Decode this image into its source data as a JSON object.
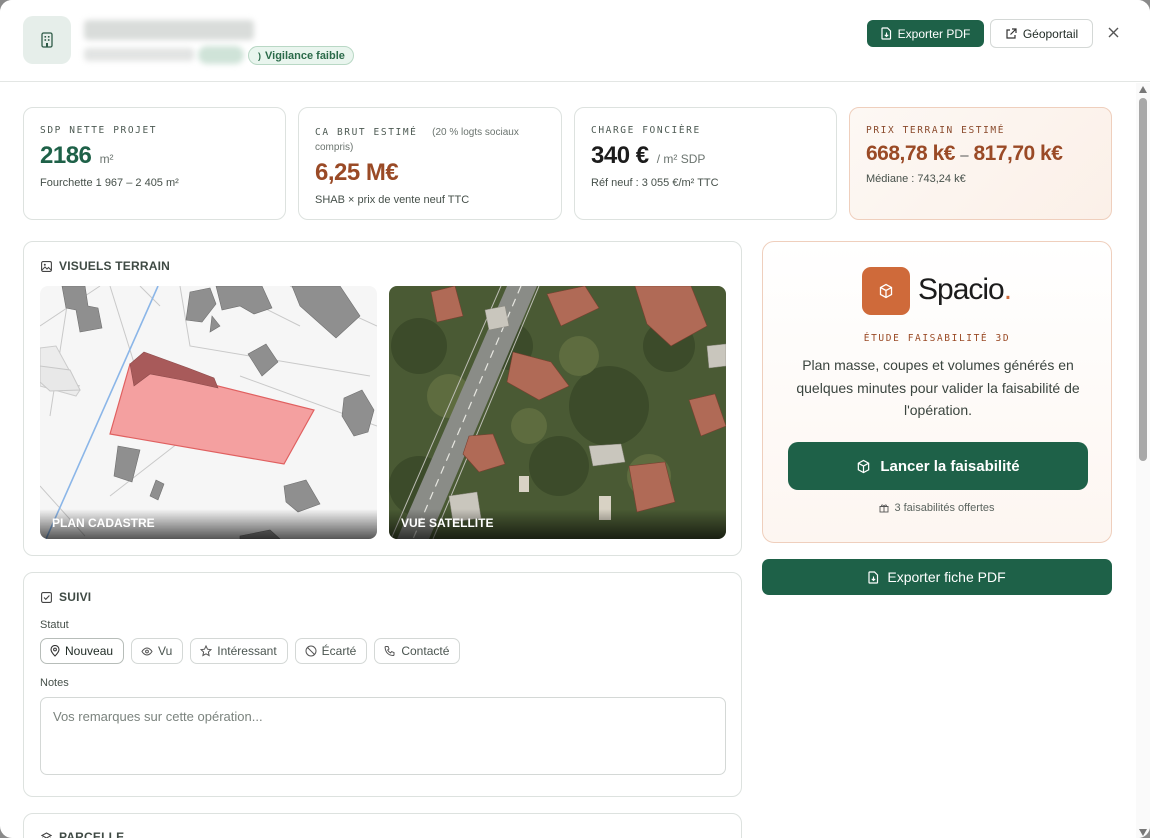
{
  "header": {
    "vigilance_label": "Vigilance faible",
    "export_pdf_label": "Exporter PDF",
    "geoportail_label": "Géoportail"
  },
  "kpis": [
    {
      "label": "SDP NETTE PROJET",
      "label_extra": "",
      "value": "2186",
      "unit": "m²",
      "note": "Fourchette 1 967 – 2 405 m²"
    },
    {
      "label": "CA BRUT ESTIMÉ",
      "label_extra": "(20 % logts sociaux compris)",
      "value": "6,25 M€",
      "unit": "",
      "note": "SHAB × prix de vente neuf TTC"
    },
    {
      "label": "CHARGE FONCIÈRE",
      "label_extra": "",
      "value": "340 €",
      "unit": "/ m² SDP",
      "note": "Réf neuf : 3 055 €/m² TTC"
    },
    {
      "label": "PRIX TERRAIN ESTIMÉ",
      "label_extra": "",
      "value": "668,78 k€",
      "value_sep": "–",
      "value2": "817,70 k€",
      "unit": "",
      "note": "Médiane : 743,24 k€"
    }
  ],
  "visuels": {
    "title": "VISUELS TERRAIN",
    "cadastre_caption": "PLAN CADASTRE",
    "satellite_caption": "VUE SATELLITE"
  },
  "suivi": {
    "title": "SUIVI",
    "statut_label": "Statut",
    "statuses": [
      "Nouveau",
      "Vu",
      "Intéressant",
      "Écarté",
      "Contacté"
    ],
    "active_status": "Nouveau",
    "notes_label": "Notes",
    "notes_placeholder": "Vos remarques sur cette opération...",
    "notes_value": ""
  },
  "parcelle": {
    "title": "PARCELLE"
  },
  "spacio": {
    "name": "Spacio",
    "name_dot": ".",
    "tagline": "ÉTUDE FAISABILITÉ 3D",
    "description": "Plan masse, coupes et volumes générés en quelques minutes pour valider la faisabilité de l'opération.",
    "cta_label": "Lancer la faisabilité",
    "offer_text": "3 faisabilités offertes"
  },
  "export_fiche_label": "Exporter fiche PDF",
  "colors": {
    "primary_green": "#1e6148",
    "accent_rust": "#9a4a26",
    "spacio_orange": "#cf6a3a",
    "parcel_red": "#f4a0a0"
  }
}
